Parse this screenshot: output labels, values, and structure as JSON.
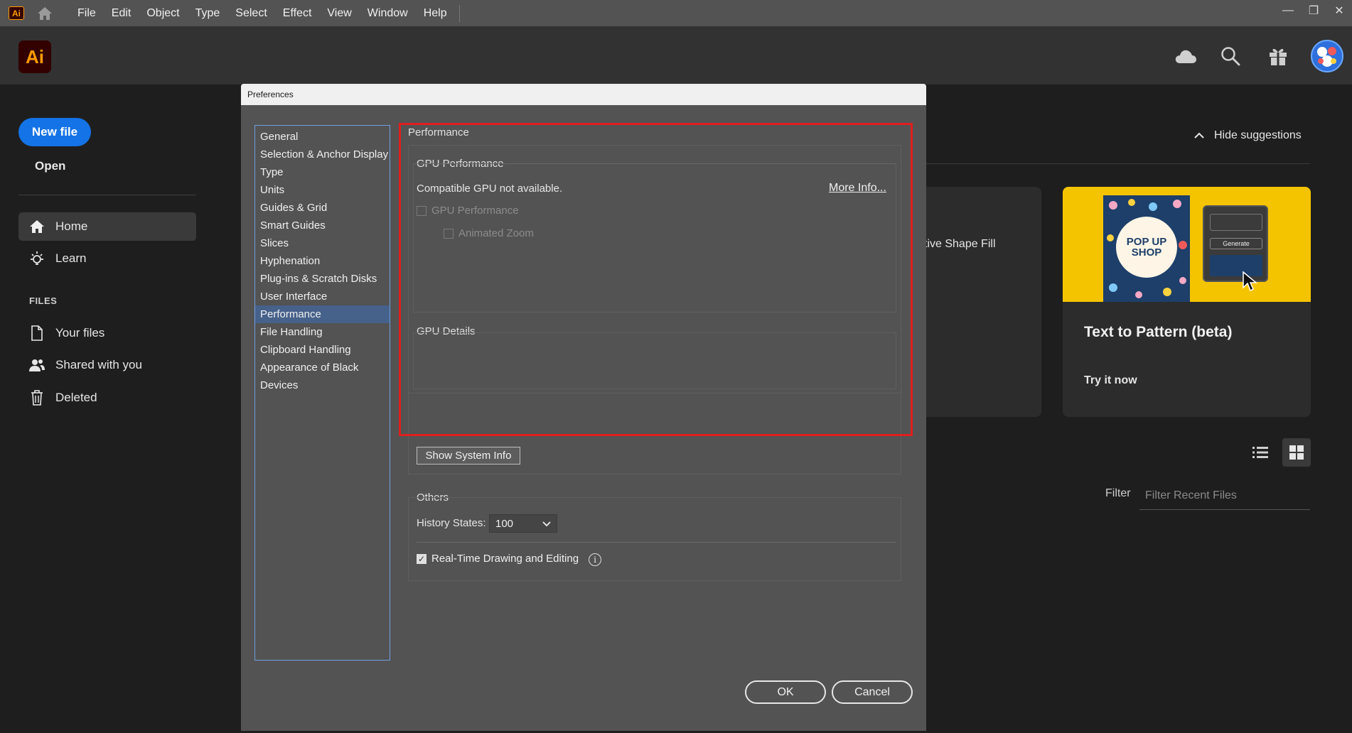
{
  "menubar": {
    "app_badge": "Ai",
    "items": [
      "File",
      "Edit",
      "Object",
      "Type",
      "Select",
      "Effect",
      "View",
      "Window",
      "Help"
    ]
  },
  "header": {
    "logo": "Ai",
    "icons": [
      "cloud-icon",
      "search-icon",
      "gift-icon"
    ]
  },
  "sidebar": {
    "new_file": "New file",
    "open": "Open",
    "nav": [
      {
        "label": "Home",
        "icon": "home-icon"
      },
      {
        "label": "Learn",
        "icon": "lightbulb-icon"
      }
    ],
    "files_heading": "FILES",
    "files": [
      {
        "label": "Your files",
        "icon": "file-icon"
      },
      {
        "label": "Shared with you",
        "icon": "shared-users-icon"
      },
      {
        "label": "Deleted",
        "icon": "trash-icon"
      }
    ]
  },
  "home": {
    "hide_suggestions": "Hide suggestions",
    "partial_card_text": "tive Shape Fill",
    "card": {
      "title": "Text to Pattern (beta)",
      "cta": "Try it now",
      "poster_text": "POP UP SHOP",
      "mock_button": "Generate"
    },
    "filter_label": "Filter",
    "filter_placeholder": "Filter Recent Files"
  },
  "dialog": {
    "title": "Preferences",
    "categories": [
      "General",
      "Selection & Anchor Display",
      "Type",
      "Units",
      "Guides & Grid",
      "Smart Guides",
      "Slices",
      "Hyphenation",
      "Plug-ins & Scratch Disks",
      "User Interface",
      "Performance",
      "File Handling",
      "Clipboard Handling",
      "Appearance of Black",
      "Devices"
    ],
    "selected_category": "Performance",
    "pane_title": "Performance",
    "gpu_section": "GPU Performance",
    "gpu_status": "Compatible GPU not available.",
    "more_info": "More Info...",
    "gpu_checkbox": "GPU Performance",
    "animated_zoom": "Animated Zoom",
    "gpu_details": "GPU Details",
    "show_system_info": "Show System Info",
    "others": "Others",
    "history_label": "History States:",
    "history_value": "100",
    "realtime_label": "Real-Time Drawing and Editing",
    "ok": "OK",
    "cancel": "Cancel"
  },
  "colors": {
    "accent": "#1473e6",
    "highlight": "#e01e1e",
    "selected_category": "#46618a",
    "dialog_bg": "#535353",
    "app_bg": "#1e1e1e"
  }
}
